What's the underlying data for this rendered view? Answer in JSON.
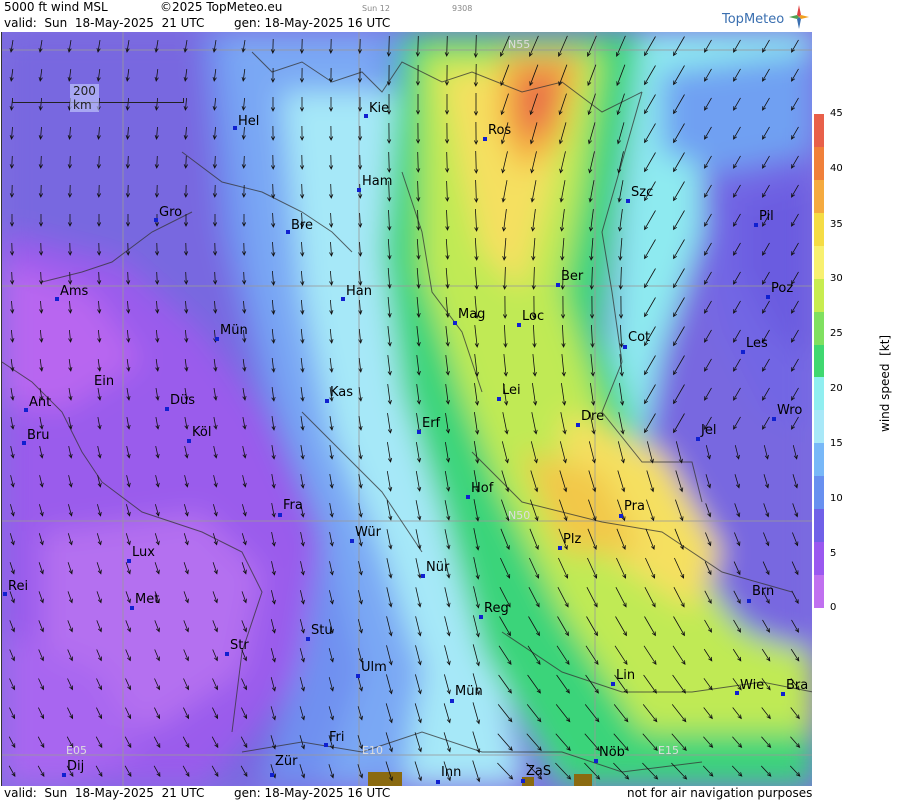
{
  "header": {
    "product": "5000 ft wind MSL",
    "copyright": "©2025 TopMeteo.eu",
    "day_label": "Sun 12",
    "code": "9308",
    "valid": "valid:  Sun  18-May-2025  21 UTC",
    "generated": "gen: 18-May-2025 16 UTC",
    "logo": "TopMeteo"
  },
  "footer": {
    "valid": "valid:  Sun  18-May-2025  21 UTC",
    "generated": "gen: 18-May-2025 16 UTC",
    "disclaimer": "not for air navigation purposes"
  },
  "map": {
    "scale_label": "200 km",
    "grid_labels": [
      "N55",
      "N50",
      "E05",
      "E10",
      "E15"
    ],
    "cities": [
      "Kie",
      "Hel",
      "Ros",
      "Ham",
      "Szc",
      "Gro",
      "Bre",
      "Pil",
      "Ber",
      "Ams",
      "Han",
      "Poz",
      "Mag",
      "Loc",
      "Cot",
      "Mün",
      "Les",
      "Ein",
      "Lei",
      "Kas",
      "Ant",
      "Düs",
      "Wro",
      "Erf",
      "Dre",
      "Bru",
      "Köl",
      "Jel",
      "Hof",
      "Fra",
      "Pra",
      "Würz",
      "Plz",
      "Lux",
      "Nür",
      "Rei",
      "Met",
      "Reg",
      "Brn",
      "Stu",
      "Str",
      "Ulm",
      "Lin",
      "Wie",
      "Bra",
      "Mün2",
      "Fri",
      "Nöb",
      "Dij",
      "Zür",
      "Inn",
      "ZaS"
    ],
    "city_names": {
      "Kie": "Kie",
      "Hel": "Hel",
      "Ros": "Ros",
      "Ham": "Ham",
      "Szc": "Szc",
      "Gro": "Gro",
      "Bre": "Bre",
      "Pil": "Pil",
      "Ber": "Ber",
      "Ams": "Ams",
      "Han": "Han",
      "Poz": "Poz",
      "Mag": "Mag",
      "Loc": "Loc",
      "Cot": "Cot",
      "Mün": "Mün",
      "Les": "Les",
      "Ein": "Ein",
      "Lei": "Lei",
      "Kas": "Kas",
      "Ant": "Ant",
      "Düs": "Düs",
      "Wro": "Wro",
      "Erf": "Erf",
      "Dre": "Dre",
      "Bru": "Bru",
      "Köl": "Köl",
      "Jel": "Jel",
      "Hof": "Hof",
      "Fra": "Fra",
      "Pra": "Pra",
      "Würz": "Wür",
      "Plz": "Plz",
      "Lux": "Lux",
      "Nür": "Nür",
      "Rei": "Rei",
      "Met": "Met",
      "Reg": "Reg",
      "Brn": "Brn",
      "Stu": "Stu",
      "Str": "Str",
      "Ulm": "Ulm",
      "Lin": "Lin",
      "Wie": "Wie",
      "Bra": "Bra",
      "Mün2": "Mün",
      "Fri": "Fri",
      "Nöb": "Nöb",
      "Dij": "Dij",
      "Zür": "Zür",
      "Inn": "Inn",
      "ZaS": "ZaS"
    }
  },
  "colorbar": {
    "title": "wind speed  [kt]",
    "ticks": [
      "45",
      "40",
      "35",
      "30",
      "25",
      "20",
      "15",
      "10",
      "5",
      "0"
    ],
    "colors": [
      "#e8604a",
      "#f0803a",
      "#f5aa40",
      "#f5dc45",
      "#f8f070",
      "#c8ec50",
      "#80e060",
      "#40d870",
      "#90eef0",
      "#a8e8f8",
      "#78b8f8",
      "#6890f0",
      "#7060e8",
      "#9a58f0",
      "#c070f0"
    ]
  }
}
